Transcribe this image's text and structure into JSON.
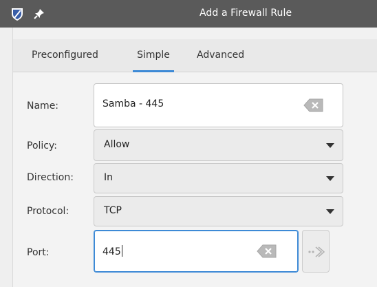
{
  "window": {
    "title": "Add a Firewall Rule"
  },
  "tabs": [
    {
      "label": "Preconfigured",
      "active": false
    },
    {
      "label": "Simple",
      "active": true
    },
    {
      "label": "Advanced",
      "active": false
    }
  ],
  "form": {
    "name": {
      "label": "Name:",
      "value": "Samba - 445"
    },
    "policy": {
      "label": "Policy:",
      "value": "Allow"
    },
    "direction": {
      "label": "Direction:",
      "value": "In"
    },
    "protocol": {
      "label": "Protocol:",
      "value": "TCP"
    },
    "port": {
      "label": "Port:",
      "value": "445"
    }
  },
  "colors": {
    "titlebar": "#5a5a5a",
    "accent": "#3d8ad6"
  },
  "icons": {
    "app": "shield-icon",
    "pin": "pin-icon",
    "clear": "clear-entry-icon",
    "go": "arrow-right-icon"
  }
}
